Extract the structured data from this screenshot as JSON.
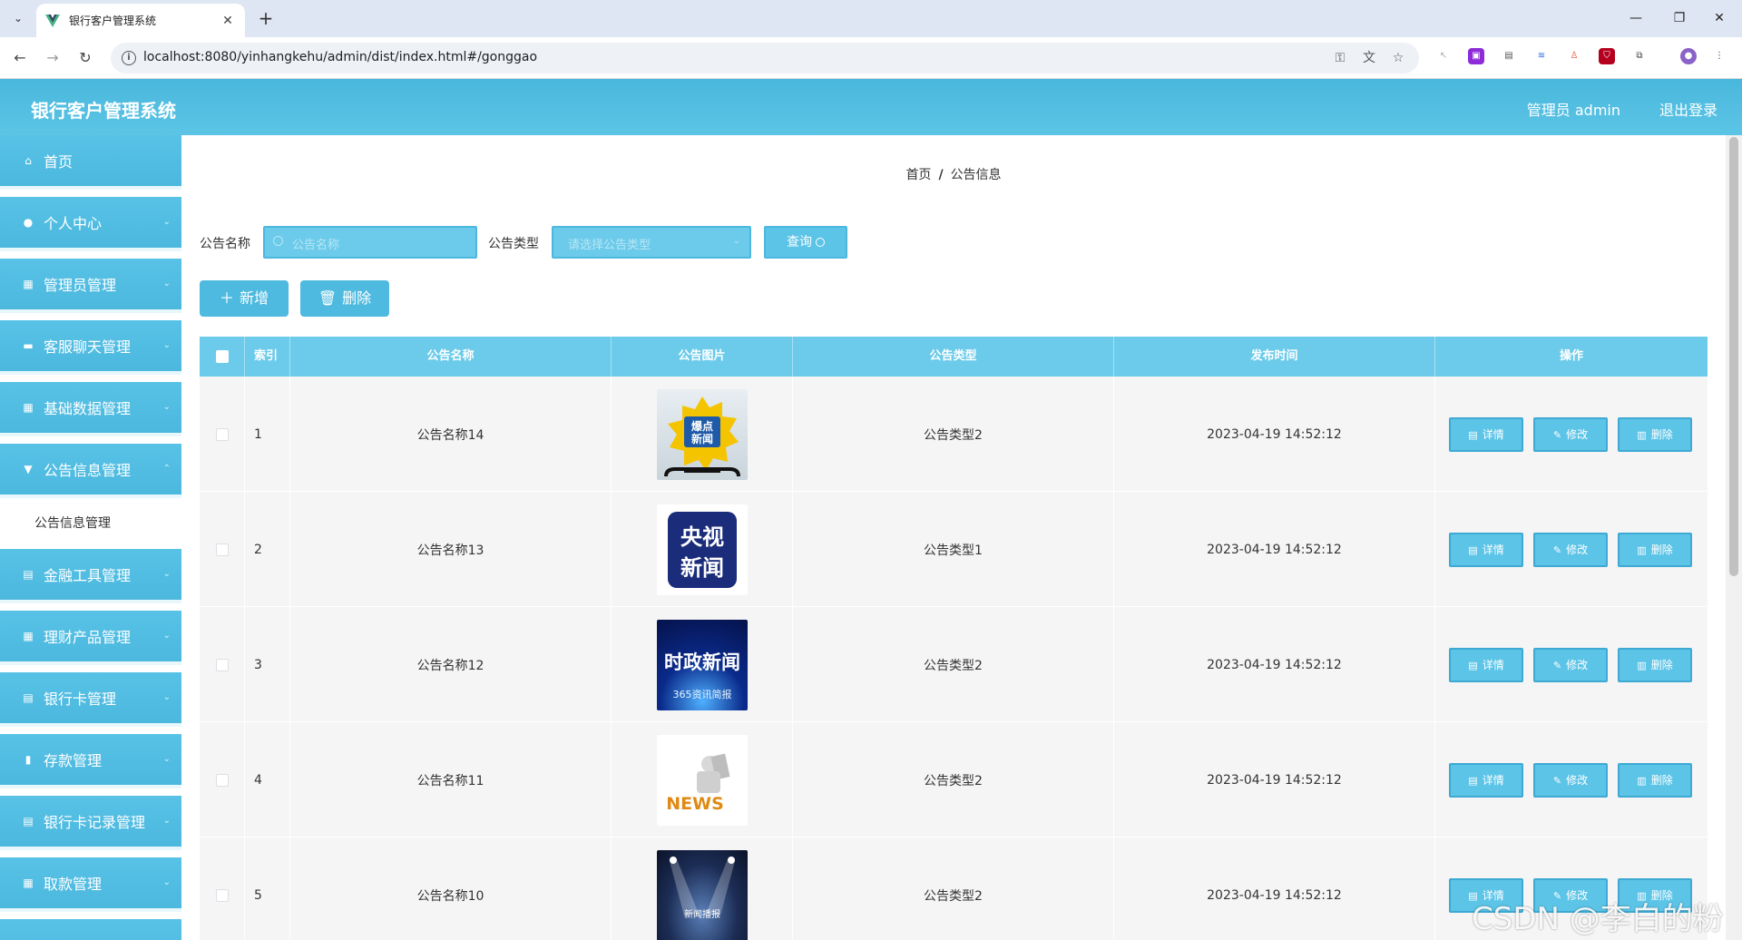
{
  "browser": {
    "tab_title": "银行客户管理系统",
    "url": "localhost:8080/yinhangkehu/admin/dist/index.html#/gonggao"
  },
  "header": {
    "title": "银行客户管理系统",
    "user": "管理员 admin",
    "logout": "退出登录"
  },
  "sidebar": {
    "items": [
      {
        "label": "首页",
        "icon": "home-icon"
      },
      {
        "label": "个人中心",
        "icon": "user-icon"
      },
      {
        "label": "管理员管理",
        "icon": "grid-icon"
      },
      {
        "label": "客服聊天管理",
        "icon": "briefcase-icon"
      },
      {
        "label": "基础数据管理",
        "icon": "grid-icon"
      },
      {
        "label": "公告信息管理",
        "icon": "filter-icon"
      },
      {
        "label": "金融工具管理",
        "icon": "clipboard-icon"
      },
      {
        "label": "理财产品管理",
        "icon": "grid-icon"
      },
      {
        "label": "银行卡管理",
        "icon": "clipboard-icon"
      },
      {
        "label": "存款管理",
        "icon": "bar-chart-icon"
      },
      {
        "label": "银行卡记录管理",
        "icon": "clipboard-icon"
      },
      {
        "label": "取款管理",
        "icon": "grid-icon"
      }
    ],
    "sub_item": "公告信息管理"
  },
  "breadcrumb": {
    "home": "首页",
    "sep": "/",
    "current": "公告信息"
  },
  "search": {
    "name_label": "公告名称",
    "name_placeholder": "公告名称",
    "type_label": "公告类型",
    "type_placeholder": "请选择公告类型",
    "query_label": "查询"
  },
  "actions": {
    "add_label": "新增",
    "delete_label": "删除"
  },
  "table": {
    "headers": [
      "索引",
      "公告名称",
      "公告图片",
      "公告类型",
      "发布时间",
      "操作"
    ],
    "op_labels": {
      "detail": "详情",
      "edit": "修改",
      "delete": "删除"
    },
    "rows": [
      {
        "index": "1",
        "name": "公告名称14",
        "image": "爆点新闻",
        "type": "公告类型2",
        "time": "2023-04-19 14:52:12"
      },
      {
        "index": "2",
        "name": "公告名称13",
        "image": "央视新闻",
        "type": "公告类型1",
        "time": "2023-04-19 14:52:12"
      },
      {
        "index": "3",
        "name": "公告名称12",
        "image": "时政新闻",
        "image_sub": "365资讯简报",
        "type": "公告类型2",
        "time": "2023-04-19 14:52:12"
      },
      {
        "index": "4",
        "name": "公告名称11",
        "image": "NEWS",
        "type": "公告类型2",
        "time": "2023-04-19 14:52:12"
      },
      {
        "index": "5",
        "name": "公告名称10",
        "image": "新闻播报",
        "type": "公告类型2",
        "time": "2023-04-19 14:52:12"
      }
    ]
  },
  "watermark": "CSDN @李白的粉",
  "colors": {
    "primary": "#4cb8de",
    "header": "#5cc5e6",
    "row_bg": "#f5f5f5"
  }
}
